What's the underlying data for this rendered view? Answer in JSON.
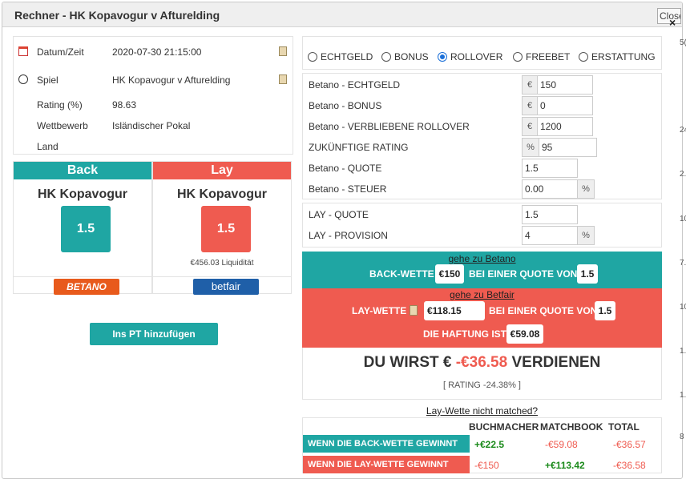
{
  "window": {
    "title": "Rechner - HK Kopavogur v Afturelding",
    "close_label": "Close",
    "close_icon": "×"
  },
  "info": {
    "rows": [
      {
        "label": "Datum/Zeit",
        "value": "2020-07-30 21:15:00",
        "icon": "calendar-icon",
        "copy": true
      },
      {
        "label": "Spiel",
        "value": "HK Kopavogur v Afturelding",
        "icon": "football-icon",
        "copy": true
      },
      {
        "label": "Rating (%)",
        "value": "98.63",
        "icon": "",
        "copy": false
      },
      {
        "label": "Wettbewerb",
        "value": "Isländischer Pokal",
        "icon": "",
        "copy": false
      },
      {
        "label": "Land",
        "value": "",
        "icon": "",
        "copy": false
      }
    ]
  },
  "back": {
    "header": "Back",
    "team": "HK Kopavogur",
    "odds": "1.5",
    "bookmaker": "BETANO",
    "color": "#1fa6a3"
  },
  "lay": {
    "header": "Lay",
    "team": "HK Kopavogur",
    "odds": "1.5",
    "liquidity": "€456.03 Liquidität",
    "exchange": "betfair",
    "color": "#ef5b50"
  },
  "add_button": "Ins PT hinzufügen",
  "radios": [
    {
      "label": "ECHTGELD",
      "checked": false
    },
    {
      "label": "BONUS",
      "checked": false
    },
    {
      "label": "ROLLOVER",
      "checked": true
    },
    {
      "label": "FREEBET",
      "checked": false
    },
    {
      "label": "ERSTATTUNG",
      "checked": false
    }
  ],
  "fields": {
    "echtgeld": {
      "label": "Betano - ECHTGELD",
      "prefix": "€",
      "value": "150"
    },
    "bonus": {
      "label": "Betano - BONUS",
      "prefix": "€",
      "value": "0"
    },
    "rollover": {
      "label": "Betano - VERBLIEBENE ROLLOVER",
      "prefix": "€",
      "value": "1200"
    },
    "future_rating": {
      "label": "ZUKÜNFTIGE RATING",
      "prefix": "%",
      "value": "95"
    },
    "quote": {
      "label": "Betano - QUOTE",
      "value": "1.5"
    },
    "tax": {
      "label": "Betano - STEUER",
      "value": "0.00",
      "suffix": "%"
    },
    "lay_quote": {
      "label": "LAY - QUOTE",
      "value": "1.5"
    },
    "lay_commission": {
      "label": "LAY - PROVISION",
      "value": "4",
      "suffix": "%"
    }
  },
  "back_panel": {
    "link": "gehe zu Betano",
    "text1": "BACK-WETTE",
    "stake": "€150",
    "text2": "BEI EINER QUOTE VON",
    "odds": "1.5"
  },
  "lay_panel": {
    "link": "gehe zu Betfair",
    "text1": "LAY-WETTE",
    "stake": "€118.15",
    "text2": "BEI EINER QUOTE VON",
    "odds": "1.5",
    "liability_text": "DIE HAFTUNG IST",
    "liability": "€59.08"
  },
  "result": {
    "prefix": "DU WIRST €",
    "amount": "-€36.58",
    "suffix": "VERDIENEN",
    "rating": "[ RATING -24.38% ]"
  },
  "unmatched_link": "Lay-Wette nicht matched?",
  "table": {
    "headers": [
      "BUCHMACHER",
      "MATCHBOOK",
      "TOTAL"
    ],
    "rows": [
      {
        "label": "WENN DIE BACK-WETTE GEWINNT",
        "bookmaker": "+€22.5",
        "matchbook": "-€59.08",
        "total": "-€36.57"
      },
      {
        "label": "WENN DIE LAY-WETTE GEWINNT",
        "bookmaker": "-€150",
        "matchbook": "+€113.42",
        "total": "-€36.58"
      }
    ]
  },
  "background_chars": [
    "5(",
    "24",
    "2.",
    "10",
    "7.",
    "10",
    "1.",
    "1.",
    "8"
  ]
}
